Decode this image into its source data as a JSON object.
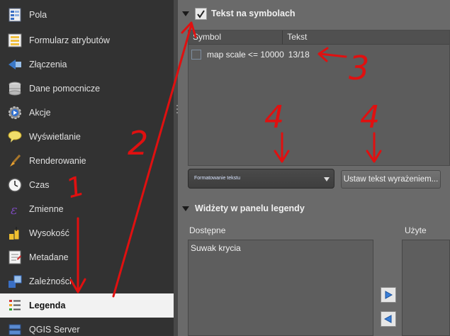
{
  "sidebar": {
    "items": [
      {
        "label": "Pola",
        "icon": "fields-icon"
      },
      {
        "label": "Formularz atrybutów",
        "icon": "form-icon"
      },
      {
        "label": "Złączenia",
        "icon": "joins-icon"
      },
      {
        "label": "Dane pomocnicze",
        "icon": "auxiliary-storage-icon"
      },
      {
        "label": "Akcje",
        "icon": "actions-icon"
      },
      {
        "label": "Wyświetlanie",
        "icon": "display-tip-icon"
      },
      {
        "label": "Renderowanie",
        "icon": "rendering-brush-icon"
      },
      {
        "label": "Czas",
        "icon": "clock-icon"
      },
      {
        "label": "Zmienne",
        "icon": "variables-icon"
      },
      {
        "label": "Wysokość",
        "icon": "elevation-icon"
      },
      {
        "label": "Metadane",
        "icon": "metadata-icon"
      },
      {
        "label": "Zależności",
        "icon": "dependencies-icon"
      },
      {
        "label": "Legenda",
        "icon": "legend-icon"
      },
      {
        "label": "QGIS Server",
        "icon": "server-icon"
      }
    ],
    "selected": "Legenda"
  },
  "text_on_symbols": {
    "title": "Tekst na symbolach",
    "checked": true,
    "columns": [
      "Symbol",
      "Tekst"
    ],
    "rows": [
      {
        "symbol": "map scale <= 10000",
        "text": "13/18"
      }
    ],
    "format_dropdown": "Formatowanie tekstu",
    "expression_button": "Ustaw tekst wyrażeniem..."
  },
  "legend_widgets": {
    "title": "Widżety w panelu legendy",
    "available_label": "Dostępne",
    "used_label": "Użyte",
    "available_items": [
      "Suwak krycia"
    ],
    "used_items": []
  },
  "annotations": [
    "1",
    "2",
    "3",
    "4",
    "4"
  ],
  "colors": {
    "annotation": "#e01010",
    "selection": "#f2f2f2",
    "sidebar_bg": "#323232"
  }
}
